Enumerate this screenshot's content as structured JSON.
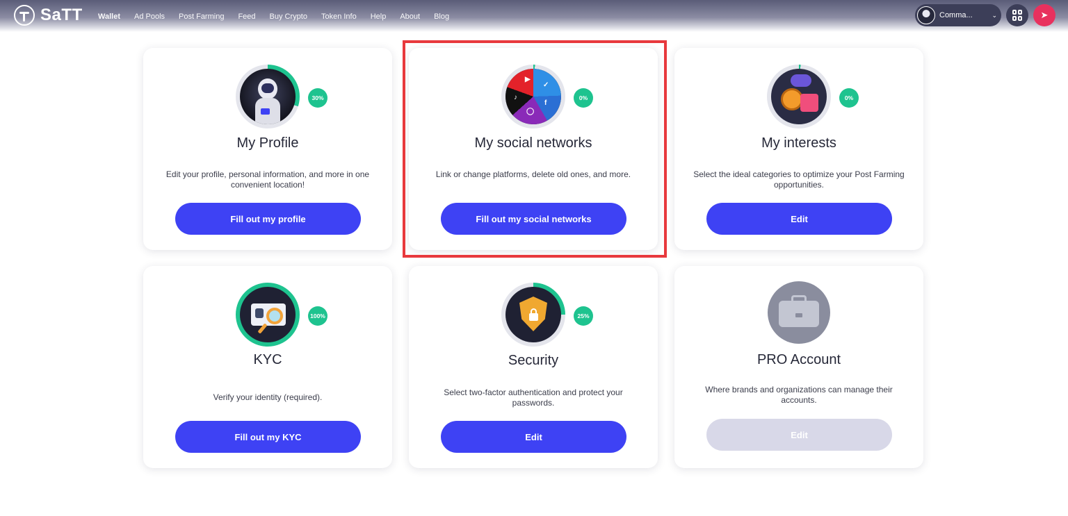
{
  "header": {
    "logo_text": "SaTT",
    "nav": [
      "Wallet",
      "Ad Pools",
      "Post Farming",
      "Feed",
      "Buy Crypto",
      "Token Info",
      "Help",
      "About",
      "Blog"
    ],
    "account_name": "Comma...",
    "icons": {
      "logo": "satt-logo-icon",
      "qr": "qr-code-icon",
      "gift": "gift-icon",
      "chevron": "chevron-down-icon"
    },
    "colors": {
      "accent": "#3e42f4",
      "progress": "#1ec38f",
      "highlight": "#e8393d"
    }
  },
  "cards": [
    {
      "title": "My Profile",
      "progress": "30%",
      "progress_value": 30,
      "description": "Edit your profile, personal information, and more in one convenient location!",
      "button": "Fill out my profile"
    },
    {
      "title": "My social networks",
      "progress": "0%",
      "progress_value": 0,
      "description": "Link or change platforms, delete old ones, and more.",
      "button": "Fill out my social networks",
      "highlighted": true
    },
    {
      "title": "My interests",
      "progress": "0%",
      "progress_value": 0,
      "description": "Select the ideal categories to optimize your Post Farming opportunities.",
      "button": "Edit"
    },
    {
      "title": "KYC",
      "progress": "100%",
      "progress_value": 100,
      "description": "Verify your identity (required).",
      "button": "Fill out my KYC"
    },
    {
      "title": "Security",
      "progress": "25%",
      "progress_value": 25,
      "description": "Select two-factor authentication and protect your passwords.",
      "button": "Edit"
    },
    {
      "title": "PRO Account",
      "description": "Where brands and organizations can manage their accounts.",
      "button": "Edit",
      "button_disabled": true
    }
  ]
}
